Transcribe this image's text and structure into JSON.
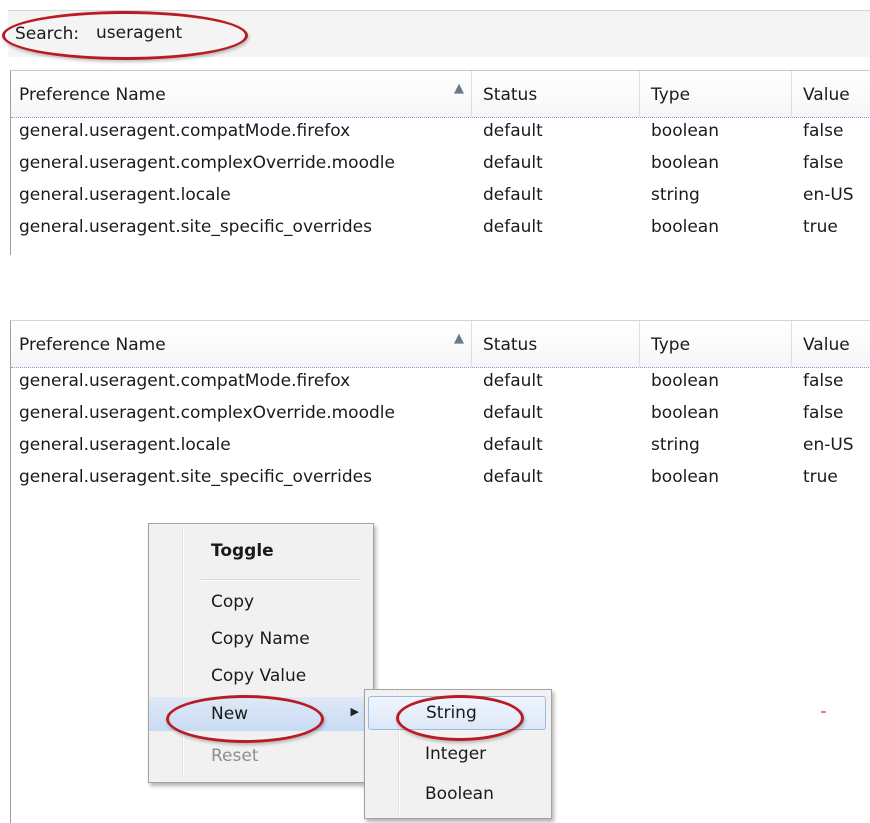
{
  "colors": {
    "highlight_oval": "#b81c22",
    "header_divider": "#7a9ccf",
    "menu_background": "#f1f1f1",
    "menu_hover": "#c9dbf3",
    "disabled_text": "#8e8e8e"
  },
  "search": {
    "label": "Search:",
    "value": "useragent"
  },
  "columns": {
    "name": "Preference Name",
    "status": "Status",
    "type": "Type",
    "value": "Value",
    "sort_icon": "sort-ascending-icon"
  },
  "rows": [
    {
      "name": "general.useragent.compatMode.firefox",
      "status": "default",
      "type": "boolean",
      "value": "false"
    },
    {
      "name": "general.useragent.complexOverride.moodle",
      "status": "default",
      "type": "boolean",
      "value": "false"
    },
    {
      "name": "general.useragent.locale",
      "status": "default",
      "type": "string",
      "value": "en-US"
    },
    {
      "name": "general.useragent.site_specific_overrides",
      "status": "default",
      "type": "boolean",
      "value": "true"
    }
  ],
  "context_menu": {
    "items": [
      {
        "label": "Toggle",
        "bold": true
      },
      {
        "label": "Copy"
      },
      {
        "label": "Copy Name"
      },
      {
        "label": "Copy Value"
      },
      {
        "label": "New",
        "submenu": true,
        "submenu_icon": "submenu-arrow-icon"
      },
      {
        "label": "Reset",
        "disabled": true
      }
    ],
    "submenu": [
      {
        "label": "String"
      },
      {
        "label": "Integer"
      },
      {
        "label": "Boolean"
      }
    ]
  }
}
